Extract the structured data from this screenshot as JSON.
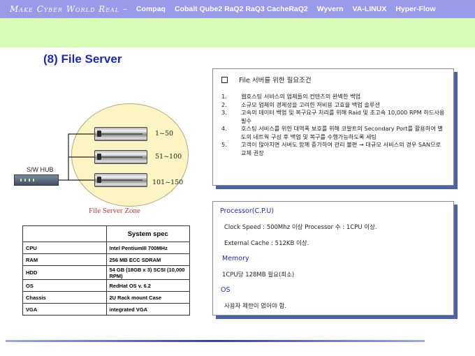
{
  "header": {
    "brand": "Make Cyber World Real –",
    "nav": [
      "Compaq",
      "Cobalt Qube2 RaQ2 RaQ3 CacheRaQ2",
      "Wyvern",
      "VA-LINUX",
      "Hyper-Flow"
    ]
  },
  "page_title": "(8) File Server",
  "diagram": {
    "hub_label": "S/W HUB",
    "ranges": [
      "1~50",
      "51~100",
      "101~150"
    ],
    "zone_label": "File Server Zone"
  },
  "spec_table": {
    "title": "System spec",
    "rows": [
      [
        "CPU",
        "Intel PentiumIII 700MHz"
      ],
      [
        "RAM",
        "256 MB ECC SDRAM"
      ],
      [
        "HDD",
        "54 GB (18GB x 3) SCSI (10,000 RPM)"
      ],
      [
        "OS",
        "RedHat OS v. 6.2"
      ],
      [
        "Chassis",
        "2U Rack mount Case"
      ],
      [
        "VGA",
        "integrated VGA"
      ]
    ]
  },
  "requirements": {
    "title": "File 서버를 위한 필요조건",
    "items": [
      {
        "num": "1.",
        "text": "웹호스팅 서비스의 업체들의 컨텐츠의 완벽한 백업"
      },
      {
        "num": "2.",
        "text": "소규모 업체의 경제성을 고려한 저비용 고효율 백업 솔루션"
      },
      {
        "num": "3.",
        "text": "고속의 데이터 백업 및 복구요구 처리를 위해 Raid 및 초고속 10,000 RPM 하드사용 필수"
      },
      {
        "num": "4.",
        "text": "호스팅 서비스를 위한 대역폭 보호를 위해 코발트의 Secondary Port를 활용하여 별도의 네트웍 구성 후 백업 및 복구를 수행가능하도록 세팅"
      },
      {
        "num": "5.",
        "text": "고객이 많아지면 서버도 함께 증가하여 관리 불편 → 대규모 서비스의 경우 SAN으로 교체 권장"
      }
    ]
  },
  "specs_panel": {
    "processor_heading": "Processor(C.P.U)",
    "processor_line1": "Clock Speed : 500Mhz 이상   Processor 수 : 1CPU 이상.",
    "processor_line2": "External Cache : 512KB 이상.",
    "memory_heading": "Memory",
    "memory_line": "1CPU당 128MB 필요(최소)",
    "os_heading": "OS",
    "os_line": "사용자 제한이 없어야 함."
  },
  "colors": {
    "header_bg": "#9b99ea",
    "green_band": "#d6fbb4",
    "title": "#1d27b8",
    "panel_shadow": "#4964a8",
    "zone_fill": "#fdf4c4",
    "zone_label": "#c0392b"
  },
  "icons": [
    "server-icon",
    "network-hub-icon",
    "checkbox-icon"
  ]
}
